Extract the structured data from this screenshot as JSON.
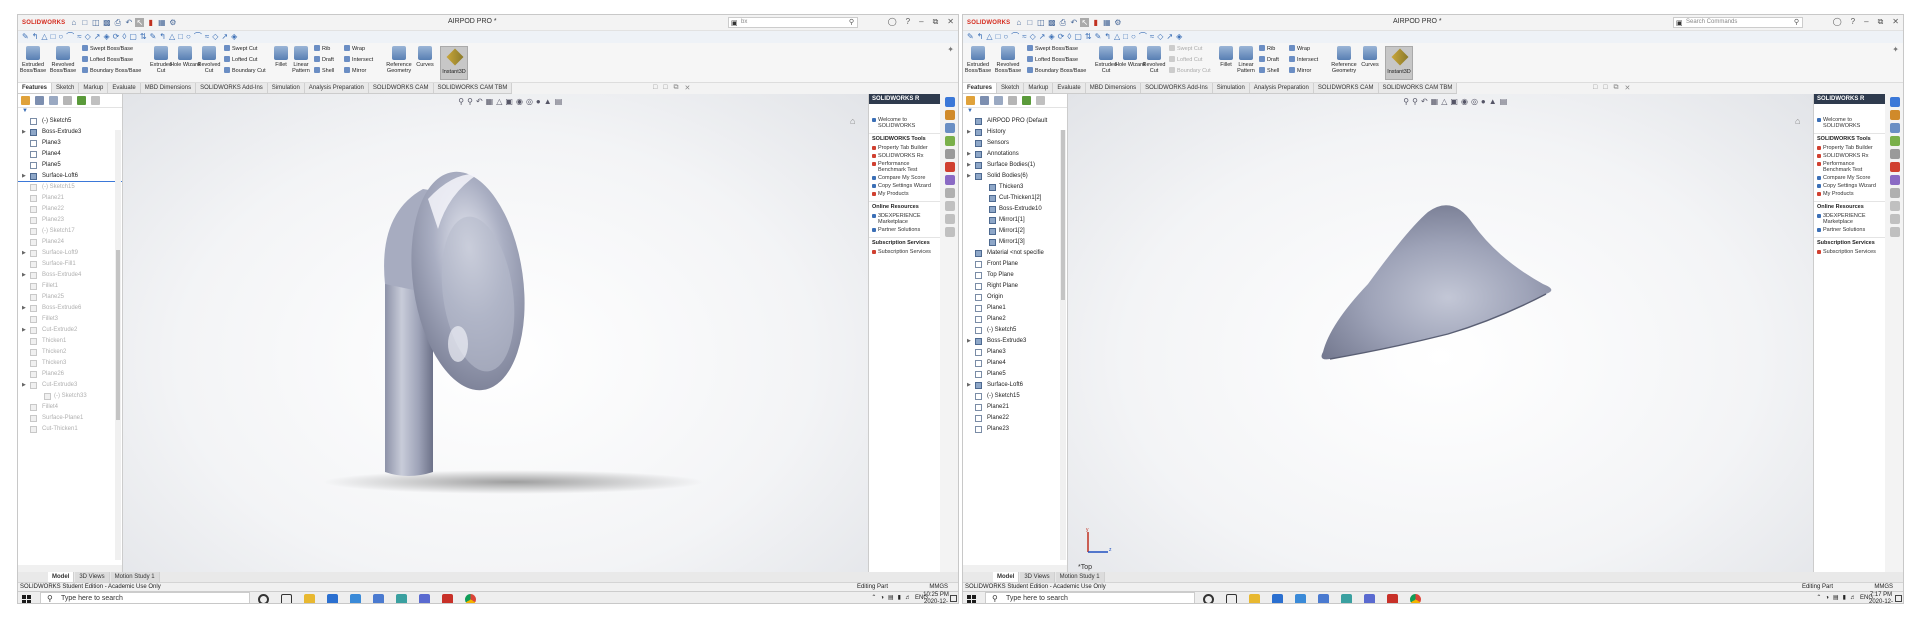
{
  "app": {
    "logo_text": "SOLIDWORKS"
  },
  "windows": [
    {
      "id": "left",
      "doc_title": "AIRPOD PRO *",
      "search_text": "bx",
      "time": "10:25 PM",
      "date": "2020-12-10",
      "tree": [
        {
          "label": "(-) Sketch5",
          "state": "normal",
          "kind": "sketch",
          "level": 1
        },
        {
          "label": "Boss-Extrude3",
          "state": "normal",
          "kind": "feat",
          "level": 1,
          "exp": true
        },
        {
          "label": "Plane3",
          "state": "normal",
          "kind": "plane",
          "level": 1
        },
        {
          "label": "Plane4",
          "state": "normal",
          "kind": "plane",
          "level": 1
        },
        {
          "label": "Plane5",
          "state": "normal",
          "kind": "plane",
          "level": 1
        },
        {
          "label": "Surface-Loft6",
          "state": "sel",
          "kind": "feat",
          "level": 1,
          "exp": true
        },
        {
          "label": "(-) Sketch15",
          "state": "dim",
          "kind": "sketch",
          "level": 1
        },
        {
          "label": "Plane21",
          "state": "dim",
          "kind": "plane",
          "level": 1
        },
        {
          "label": "Plane22",
          "state": "dim",
          "kind": "plane",
          "level": 1
        },
        {
          "label": "Plane23",
          "state": "dim",
          "kind": "plane",
          "level": 1
        },
        {
          "label": "(-) Sketch17",
          "state": "dim",
          "kind": "sketch",
          "level": 1
        },
        {
          "label": "Plane24",
          "state": "dim",
          "kind": "plane",
          "level": 1
        },
        {
          "label": "Surface-Loft9",
          "state": "dim",
          "kind": "feat",
          "level": 1,
          "exp": true
        },
        {
          "label": "Surface-Fill1",
          "state": "dim",
          "kind": "feat",
          "level": 1
        },
        {
          "label": "Boss-Extrude4",
          "state": "dim",
          "kind": "feat",
          "level": 1,
          "exp": true
        },
        {
          "label": "Fillet1",
          "state": "dim",
          "kind": "feat",
          "level": 1
        },
        {
          "label": "Plane25",
          "state": "dim",
          "kind": "plane",
          "level": 1
        },
        {
          "label": "Boss-Extrude6",
          "state": "dim",
          "kind": "feat",
          "level": 1,
          "exp": true
        },
        {
          "label": "Fillet3",
          "state": "dim",
          "kind": "feat",
          "level": 1
        },
        {
          "label": "Cut-Extrude2",
          "state": "dim",
          "kind": "feat",
          "level": 1,
          "exp": true
        },
        {
          "label": "Thicken1",
          "state": "dim",
          "kind": "feat",
          "level": 1
        },
        {
          "label": "Thicken2",
          "state": "dim",
          "kind": "feat",
          "level": 1
        },
        {
          "label": "Thicken3",
          "state": "dim",
          "kind": "feat",
          "level": 1
        },
        {
          "label": "Plane26",
          "state": "dim",
          "kind": "plane",
          "level": 1
        },
        {
          "label": "Cut-Extrude3",
          "state": "dim",
          "kind": "feat",
          "level": 1,
          "exp": true
        },
        {
          "label": "(-) Sketch33",
          "state": "dim",
          "kind": "sketch",
          "level": 2
        },
        {
          "label": "Fillet4",
          "state": "dim",
          "kind": "feat",
          "level": 1
        },
        {
          "label": "Surface-Plane1",
          "state": "dim",
          "kind": "feat",
          "level": 1
        },
        {
          "label": "Cut-Thicken1",
          "state": "dim",
          "kind": "feat",
          "level": 1
        }
      ]
    },
    {
      "id": "right",
      "doc_title": "AIRPOD PRO *",
      "search_text": "Search Commands",
      "time": "7:17 PM",
      "date": "2020-12-11",
      "tree": [
        {
          "label": "AIRPOD PRO  (Default",
          "state": "normal",
          "kind": "part",
          "level": 0
        },
        {
          "label": "History",
          "state": "normal",
          "kind": "folder",
          "level": 1,
          "exp": true
        },
        {
          "label": "Sensors",
          "state": "normal",
          "kind": "folder",
          "level": 1
        },
        {
          "label": "Annotations",
          "state": "normal",
          "kind": "folder",
          "level": 1,
          "exp": true
        },
        {
          "label": "Surface Bodies(1)",
          "state": "normal",
          "kind": "folder",
          "level": 1,
          "exp": true
        },
        {
          "label": "Solid Bodies(6)",
          "state": "normal",
          "kind": "folder",
          "level": 1,
          "exp": true
        },
        {
          "label": "Thicken3",
          "state": "normal",
          "kind": "feat",
          "level": 2
        },
        {
          "label": "Cut-Thicken1[2]",
          "state": "normal",
          "kind": "feat",
          "level": 2
        },
        {
          "label": "Boss-Extrude10",
          "state": "normal",
          "kind": "feat",
          "level": 2
        },
        {
          "label": "Mirror1[1]",
          "state": "normal",
          "kind": "feat",
          "level": 2
        },
        {
          "label": "Mirror1[2]",
          "state": "normal",
          "kind": "feat",
          "level": 2
        },
        {
          "label": "Mirror1[3]",
          "state": "normal",
          "kind": "feat",
          "level": 2
        },
        {
          "label": "Material <not specifie",
          "state": "normal",
          "kind": "folder",
          "level": 1
        },
        {
          "label": "Front Plane",
          "state": "normal",
          "kind": "plane",
          "level": 1
        },
        {
          "label": "Top Plane",
          "state": "normal",
          "kind": "plane",
          "level": 1
        },
        {
          "label": "Right Plane",
          "state": "normal",
          "kind": "plane",
          "level": 1
        },
        {
          "label": "Origin",
          "state": "normal",
          "kind": "origin",
          "level": 1
        },
        {
          "label": "Plane1",
          "state": "normal",
          "kind": "plane",
          "level": 1
        },
        {
          "label": "Plane2",
          "state": "normal",
          "kind": "plane",
          "level": 1
        },
        {
          "label": "(-) Sketch5",
          "state": "normal",
          "kind": "sketch",
          "level": 1
        },
        {
          "label": "Boss-Extrude3",
          "state": "normal",
          "kind": "feat",
          "level": 1,
          "exp": true
        },
        {
          "label": "Plane3",
          "state": "normal",
          "kind": "plane",
          "level": 1
        },
        {
          "label": "Plane4",
          "state": "normal",
          "kind": "plane",
          "level": 1
        },
        {
          "label": "Plane5",
          "state": "normal",
          "kind": "plane",
          "level": 1
        },
        {
          "label": "Surface-Loft6",
          "state": "normal",
          "kind": "feat",
          "level": 1,
          "exp": true
        },
        {
          "label": "(-) Sketch15",
          "state": "normal",
          "kind": "sketch",
          "level": 1
        },
        {
          "label": "Plane21",
          "state": "normal",
          "kind": "plane",
          "level": 1
        },
        {
          "label": "Plane22",
          "state": "normal",
          "kind": "plane",
          "level": 1
        },
        {
          "label": "Plane23",
          "state": "normal",
          "kind": "plane",
          "level": 1
        }
      ]
    }
  ],
  "ribbon": {
    "extruded_boss": "Extruded Boss/Base",
    "revolved_boss": "Revolved Boss/Base",
    "swept_boss": "Swept Boss/Base",
    "lofted_boss": "Lofted Boss/Base",
    "boundary_boss": "Boundary Boss/Base",
    "extruded_cut": "Extruded Cut",
    "hole_wizard": "Hole Wizard",
    "revolved_cut": "Revolved Cut",
    "swept_cut": "Swept Cut",
    "lofted_cut": "Lofted Cut",
    "boundary_cut": "Boundary Cut",
    "fillet": "Fillet",
    "linear_pattern": "Linear Pattern",
    "rib": "Rib",
    "draft": "Draft",
    "shell": "Shell",
    "wrap": "Wrap",
    "intersect": "Intersect",
    "mirror": "Mirror",
    "reference_geometry": "Reference Geometry",
    "curves": "Curves",
    "instant3d": "Instant3D"
  },
  "tabs": [
    "Features",
    "Sketch",
    "Markup",
    "Evaluate",
    "MBD Dimensions",
    "SOLIDWORKS Add-Ins",
    "Simulation",
    "Analysis Preparation",
    "SOLIDWORKS CAM",
    "SOLIDWORKS CAM TBM"
  ],
  "taskpane": {
    "header": "SOLIDWORKS R",
    "welcome": "Welcome to SOLIDWORKS",
    "tools_title": "SOLIDWORKS Tools",
    "tools": [
      "Property Tab Builder",
      "SOLIDWORKS Rx",
      "Performance Benchmark Test",
      "Compare My Score",
      "Copy Settings Wizard",
      "My Products"
    ],
    "online_title": "Online Resources",
    "online": [
      "3DEXPERIENCE Marketplace",
      "Partner Solutions"
    ],
    "subs_title": "Subscription Services",
    "subs": [
      "Subscription Services"
    ]
  },
  "bottom_tabs": [
    "Model",
    "3D Views",
    "Motion Study 1"
  ],
  "status": {
    "edition": "SOLIDWORKS Student Edition - Academic Use Only",
    "editing": "Editing Part",
    "units": "MMGS"
  },
  "taskbar": {
    "search_placeholder": "Type here to search",
    "lang": "ENG"
  },
  "view_label": "*Top",
  "colors": {
    "accent": "#3b78d8",
    "brand": "#d52b1e",
    "model": "#9ea3b8"
  }
}
